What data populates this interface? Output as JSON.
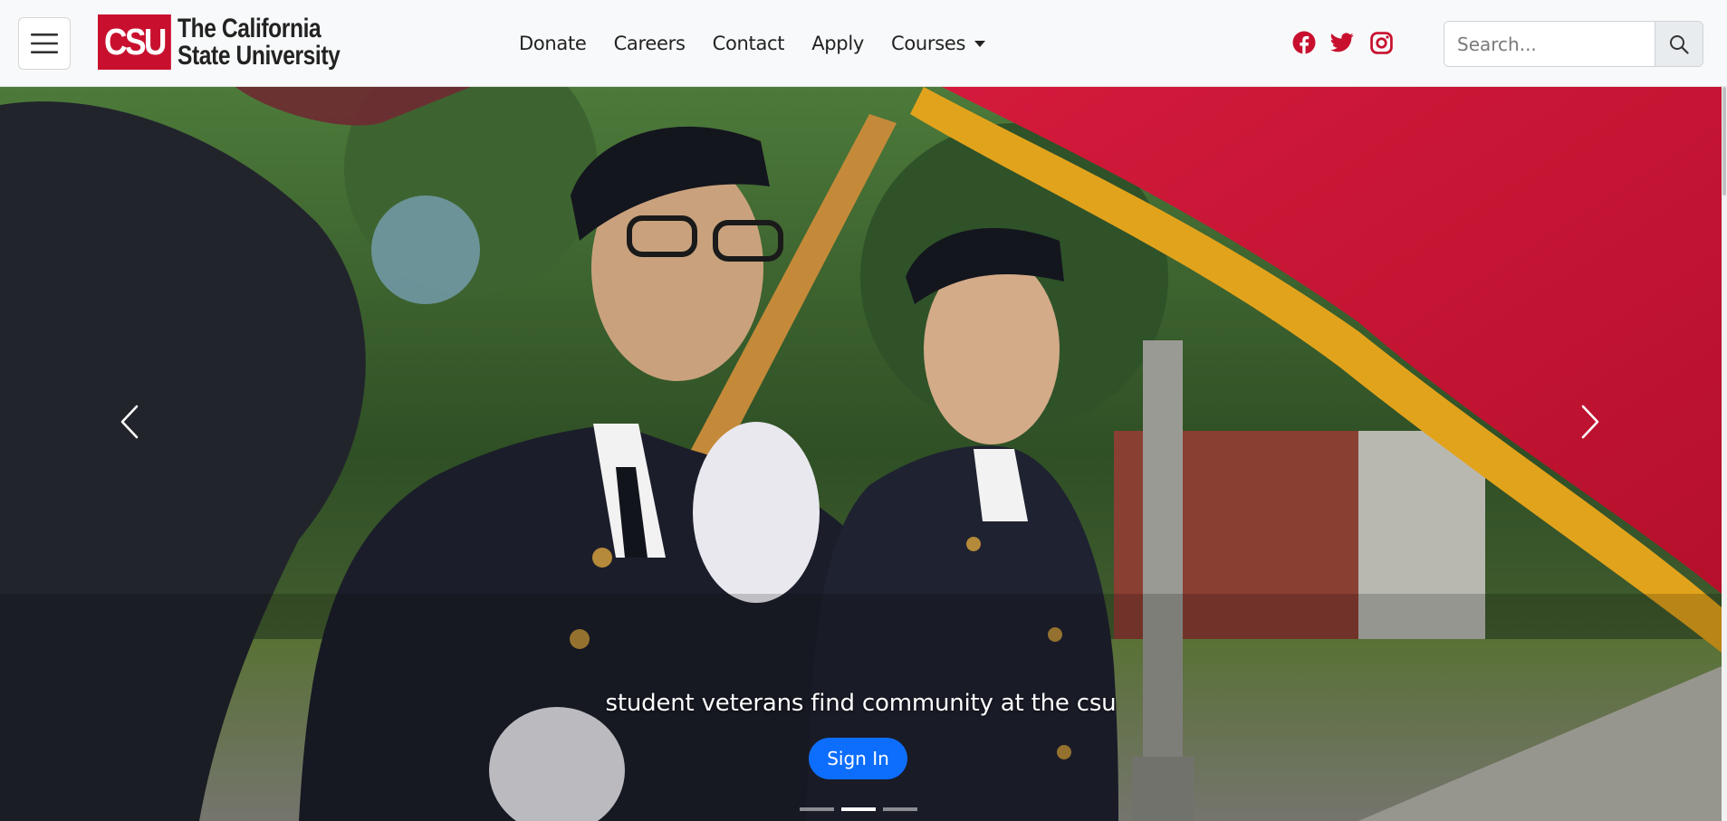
{
  "brand": {
    "mark": "CSU",
    "line1": "The California",
    "line2": "State University",
    "color": "#c8102e"
  },
  "nav": {
    "menu_icon": "hamburger-icon",
    "links": [
      "Donate",
      "Careers",
      "Contact",
      "Apply"
    ],
    "dropdown_label": "Courses"
  },
  "social": {
    "icons": [
      "facebook-icon",
      "twitter-icon",
      "instagram-icon"
    ],
    "color": "#c8102e"
  },
  "search": {
    "placeholder": "Search...",
    "value": "",
    "button_icon": "search-icon"
  },
  "carousel": {
    "caption": "student veterans find community at the csu",
    "button_label": "Sign In",
    "button_color": "#0d6efd",
    "slide_count": 3,
    "active_slide": 2,
    "prev_icon": "chevron-left-icon",
    "next_icon": "chevron-right-icon"
  }
}
